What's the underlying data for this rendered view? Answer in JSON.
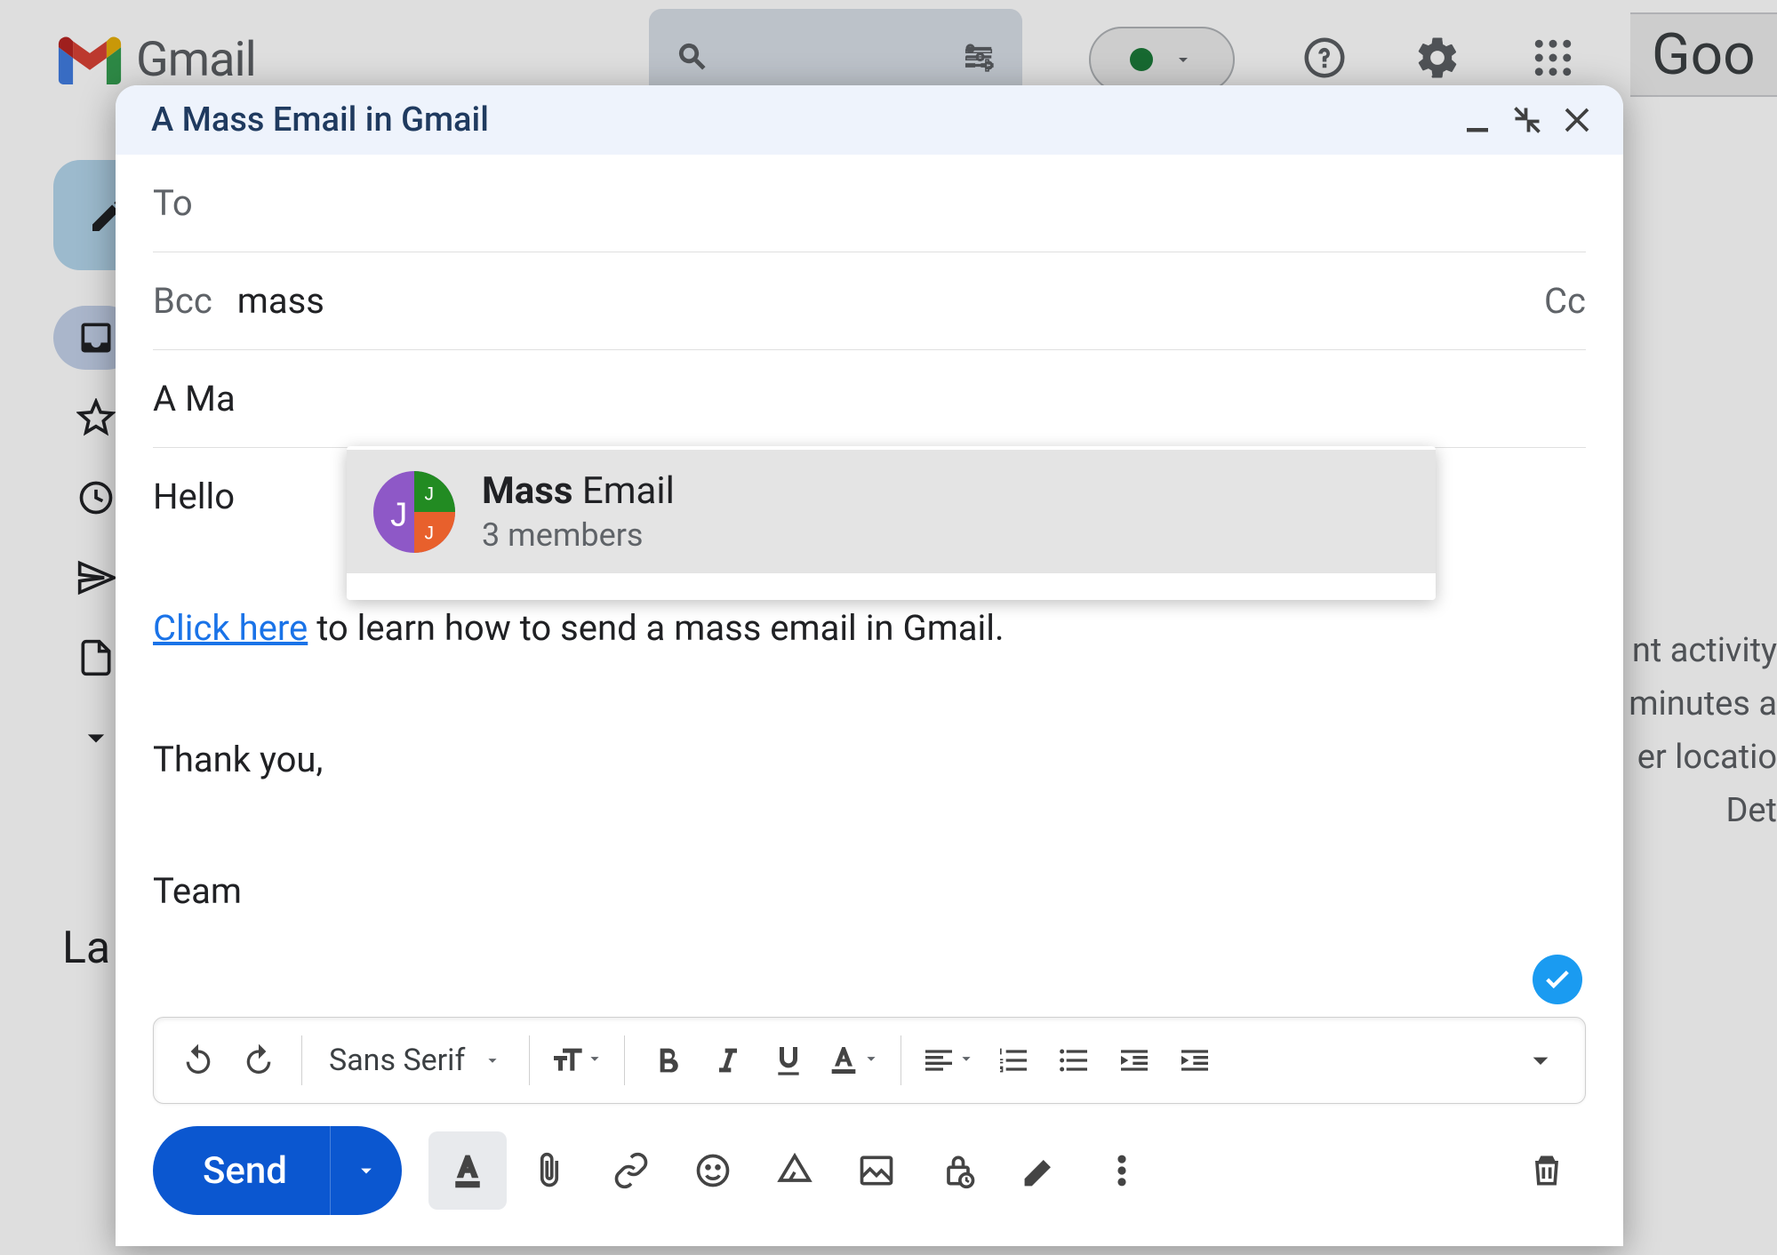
{
  "header": {
    "product": "Gmail",
    "account_label": "Goo"
  },
  "sidebar": {
    "labels_heading": "La"
  },
  "right_panel": {
    "line1": "nt activity",
    "line2": "minutes a",
    "line3": "er locatio",
    "line4": "Det"
  },
  "compose": {
    "subject_bar": "A Mass Email in Gmail",
    "to_label": "To",
    "bcc_label": "Bcc",
    "bcc_value": "mass",
    "cc_button": "Cc",
    "subject_value": "A Ma",
    "body": {
      "line1": "Hello",
      "link_text": "Click here",
      "link_followup": " to learn how to send a mass email in Gmail.",
      "line3": "Thank you,",
      "line4": "Team"
    },
    "autocomplete": {
      "match": "Mass",
      "rest": " Email",
      "sub": "3 members"
    },
    "font_family": "Sans Serif",
    "send_label": "Send"
  }
}
